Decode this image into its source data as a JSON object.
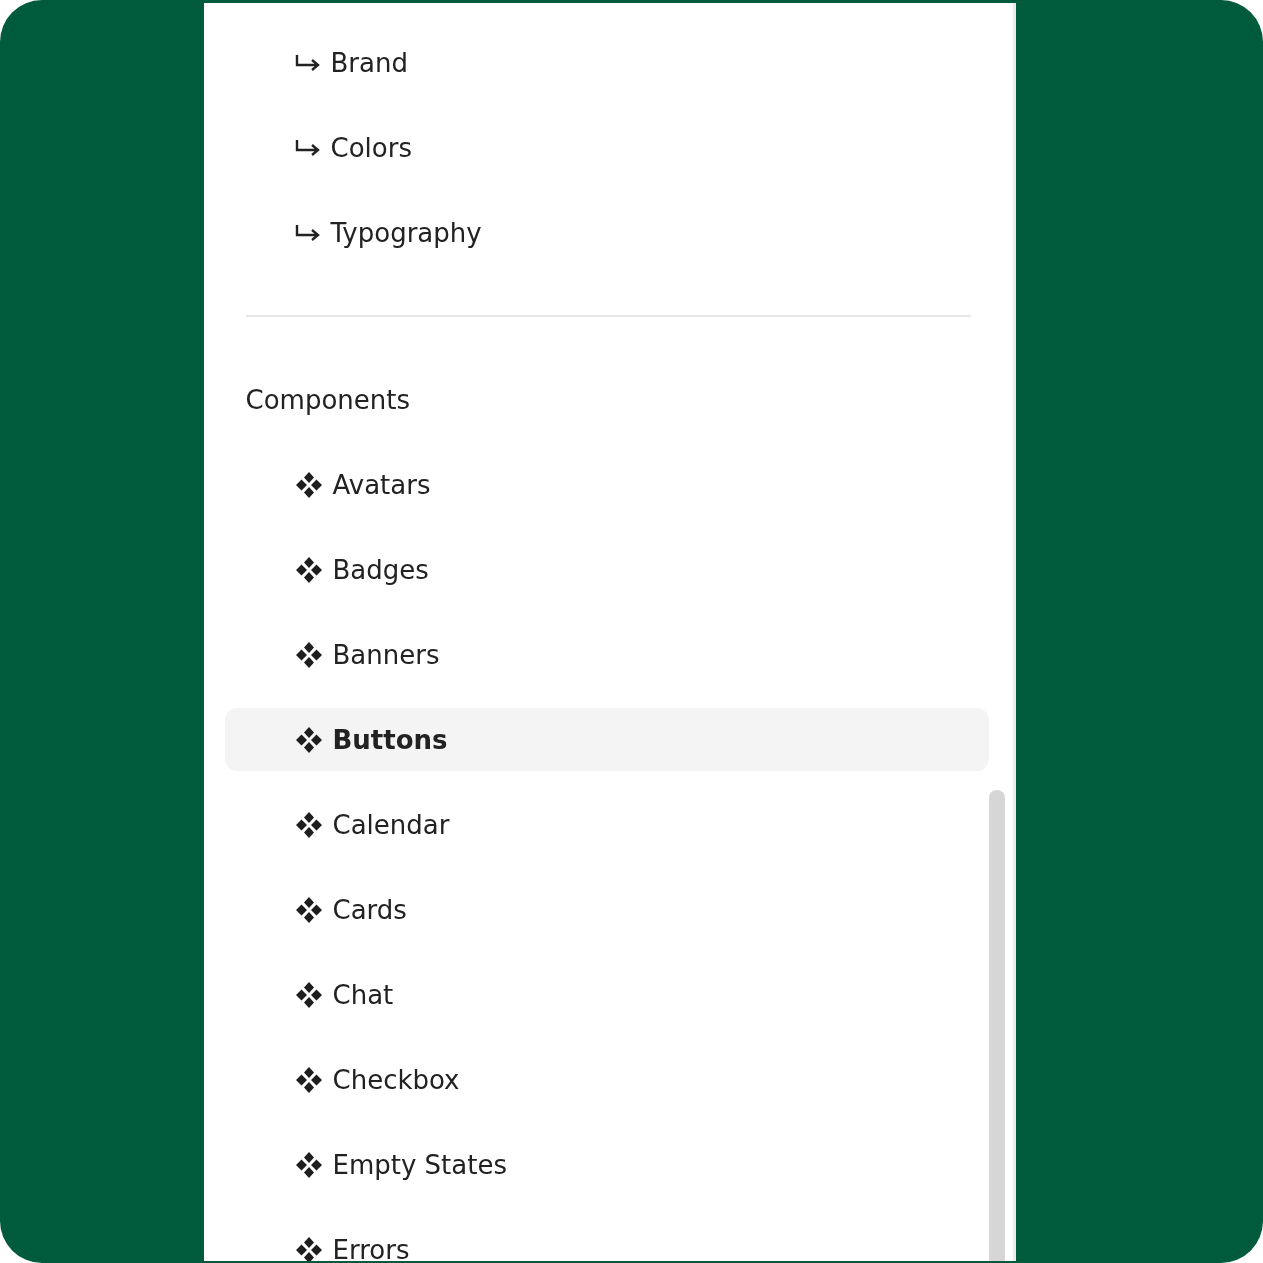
{
  "sections": [
    {
      "items": [
        {
          "label": "Brand",
          "kind": "sub",
          "selected": false
        },
        {
          "label": "Colors",
          "kind": "sub",
          "selected": false
        },
        {
          "label": "Typography",
          "kind": "sub",
          "selected": false
        }
      ]
    },
    {
      "heading": "Components",
      "items": [
        {
          "label": "Avatars",
          "kind": "component",
          "selected": false
        },
        {
          "label": "Badges",
          "kind": "component",
          "selected": false
        },
        {
          "label": "Banners",
          "kind": "component",
          "selected": false
        },
        {
          "label": "Buttons",
          "kind": "component",
          "selected": true
        },
        {
          "label": "Calendar",
          "kind": "component",
          "selected": false
        },
        {
          "label": "Cards",
          "kind": "component",
          "selected": false
        },
        {
          "label": "Chat",
          "kind": "component",
          "selected": false
        },
        {
          "label": "Checkbox",
          "kind": "component",
          "selected": false
        },
        {
          "label": "Empty States",
          "kind": "component",
          "selected": false
        },
        {
          "label": "Errors",
          "kind": "component",
          "selected": false
        }
      ]
    }
  ]
}
